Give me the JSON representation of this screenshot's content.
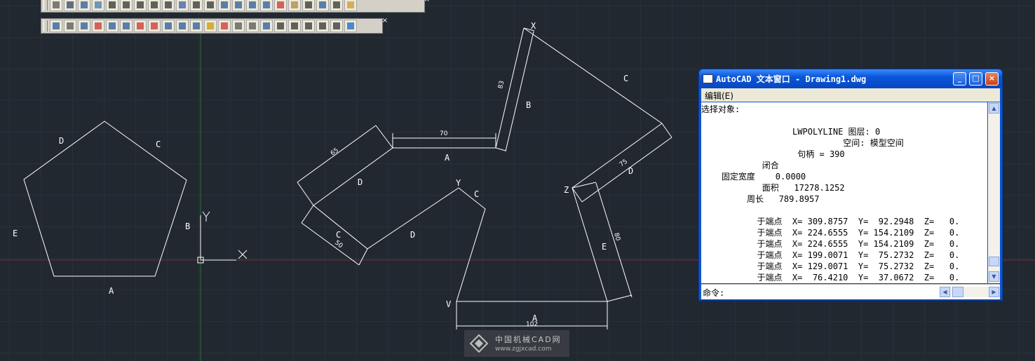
{
  "canvas": {
    "background": "#212830",
    "line_color": "#ffffff",
    "ucs_icon": {
      "x_label": "X",
      "y_label": "Y"
    },
    "pentagon": {
      "labels": [
        "A",
        "B",
        "C",
        "D",
        "E"
      ]
    },
    "figure_middle": {
      "labels": {
        "a": "A",
        "b": "B",
        "c1": "C",
        "c2": "C",
        "d1": "D",
        "d2": "D",
        "x": "X"
      },
      "dims": {
        "a": "70",
        "b": "83",
        "d": "65",
        "c": "50"
      }
    },
    "figure_right": {
      "labels": {
        "a": "A",
        "c": "C",
        "d": "D",
        "e": "E",
        "v": "V",
        "y": "Y",
        "z": "Z"
      },
      "dims": {
        "a": "102",
        "d": "75",
        "e": "80"
      }
    }
  },
  "toolbars": {
    "top": {
      "close": "×"
    },
    "second": {
      "close": "×"
    }
  },
  "text_window": {
    "title": "AutoCAD 文本窗口 - Drawing1.dwg",
    "controls": {
      "minimize": "_",
      "maximize": "□",
      "close": "×"
    },
    "menu_edit": "编辑(E)",
    "lines": [
      "选择对象:",
      "",
      "                  LWPOLYLINE 图层: 0",
      "                            空间: 模型空间",
      "                   句柄 = 390",
      "            闭合",
      "    固定宽度    0.0000",
      "            面积   17278.1252",
      "         周长   789.8957",
      "",
      "           于端点  X= 309.8757  Y=  92.2948  Z=   0.",
      "           于端点  X= 224.6555  Y= 154.2109  Z=   0.",
      "           于端点  X= 224.6555  Y= 154.2109  Z=   0.",
      "           于端点  X= 199.0071  Y=  75.2732  Z=   0.",
      "           于端点  X= 129.0071  Y=  75.2732  Z=   0.",
      "           于端点  X=  76.4210  Y=  37.0672  Z=   0."
    ],
    "command_label": "命令:"
  },
  "watermark": {
    "name": "中国机械CAD网",
    "url": "www.zgjxcad.com"
  }
}
